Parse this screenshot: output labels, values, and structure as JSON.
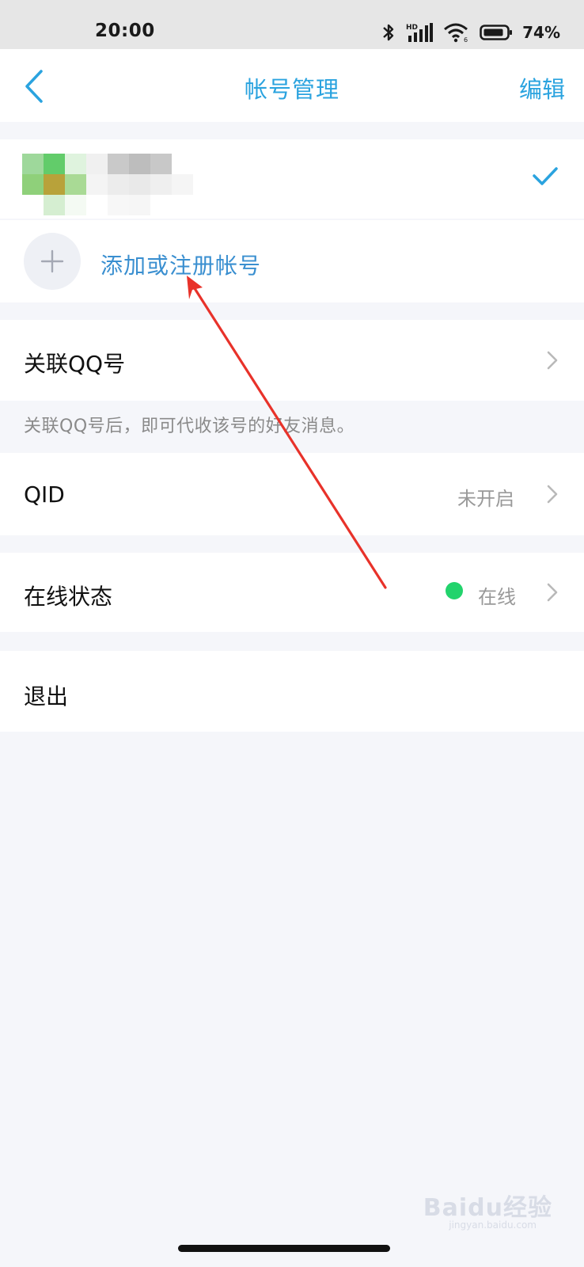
{
  "status_bar": {
    "time": "20:00",
    "battery_percent": "74%",
    "icons": [
      "bluetooth-icon",
      "signal-icon",
      "wifi-icon",
      "battery-icon"
    ]
  },
  "nav": {
    "title": "帐号管理",
    "edit_label": "编辑",
    "back_icon": "chevron-left-icon"
  },
  "account": {
    "selected": true,
    "check_icon": "check-icon"
  },
  "add_account": {
    "label": "添加或注册帐号",
    "icon": "plus-icon"
  },
  "rows": {
    "link_qq": {
      "label": "关联QQ号"
    },
    "link_qq_hint": "关联QQ号后，即可代收该号的好友消息。",
    "qid": {
      "label": "QID",
      "value": "未开启"
    },
    "online_status": {
      "label": "在线状态",
      "value": "在线"
    },
    "logout": {
      "label": "退出"
    }
  },
  "watermark": {
    "main": "Baidu经验",
    "sub": "jingyan.baidu.com"
  },
  "colors": {
    "accent": "#2aa3df",
    "link": "#3a8fd0",
    "online": "#22d36c",
    "background": "#f5f6fa",
    "annotation_arrow": "#e8322a"
  }
}
